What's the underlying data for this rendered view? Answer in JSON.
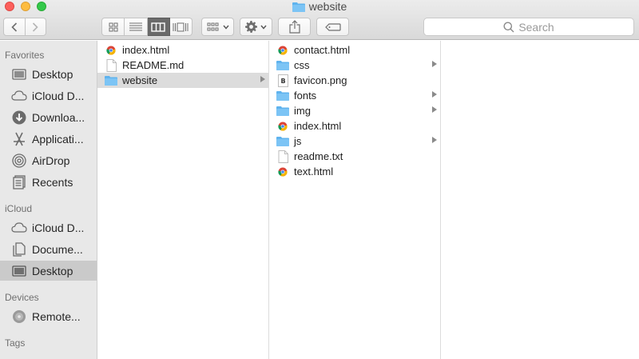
{
  "window": {
    "title": "website"
  },
  "toolbar": {
    "search_placeholder": "Search"
  },
  "sidebar": {
    "sections": [
      {
        "heading": "Favorites",
        "items": [
          {
            "label": "Desktop",
            "icon": "desktop-icon"
          },
          {
            "label": "iCloud D...",
            "icon": "cloud-icon"
          },
          {
            "label": "Downloa...",
            "icon": "download-icon"
          },
          {
            "label": "Applicati...",
            "icon": "applications-icon"
          },
          {
            "label": "AirDrop",
            "icon": "airdrop-icon"
          },
          {
            "label": "Recents",
            "icon": "recents-icon"
          }
        ]
      },
      {
        "heading": "iCloud",
        "items": [
          {
            "label": "iCloud D...",
            "icon": "cloud-icon"
          },
          {
            "label": "Docume...",
            "icon": "documents-icon"
          },
          {
            "label": "Desktop",
            "icon": "desktop-icon",
            "selected": true
          }
        ]
      },
      {
        "heading": "Devices",
        "items": [
          {
            "label": "Remote...",
            "icon": "disc-icon"
          }
        ]
      },
      {
        "heading": "Tags",
        "items": []
      }
    ]
  },
  "columns": [
    {
      "items": [
        {
          "label": "index.html",
          "icon": "chrome-doc-icon"
        },
        {
          "label": "README.md",
          "icon": "blank-doc-icon"
        },
        {
          "label": "website",
          "icon": "folder-icon",
          "folder": true,
          "selected": true
        }
      ]
    },
    {
      "items": [
        {
          "label": "contact.html",
          "icon": "chrome-doc-icon"
        },
        {
          "label": "css",
          "icon": "folder-icon",
          "folder": true
        },
        {
          "label": "favicon.png",
          "icon": "image-doc-icon"
        },
        {
          "label": "fonts",
          "icon": "folder-icon",
          "folder": true
        },
        {
          "label": "img",
          "icon": "folder-icon",
          "folder": true
        },
        {
          "label": "index.html",
          "icon": "chrome-doc-icon"
        },
        {
          "label": "js",
          "icon": "folder-icon",
          "folder": true
        },
        {
          "label": "readme.txt",
          "icon": "blank-doc-icon"
        },
        {
          "label": "text.html",
          "icon": "chrome-doc-icon"
        }
      ]
    },
    {
      "items": []
    }
  ],
  "colors": {
    "folder": "#5fb3ee",
    "selection": "#dcdcdc",
    "sidebar_selection": "#cacaca"
  }
}
